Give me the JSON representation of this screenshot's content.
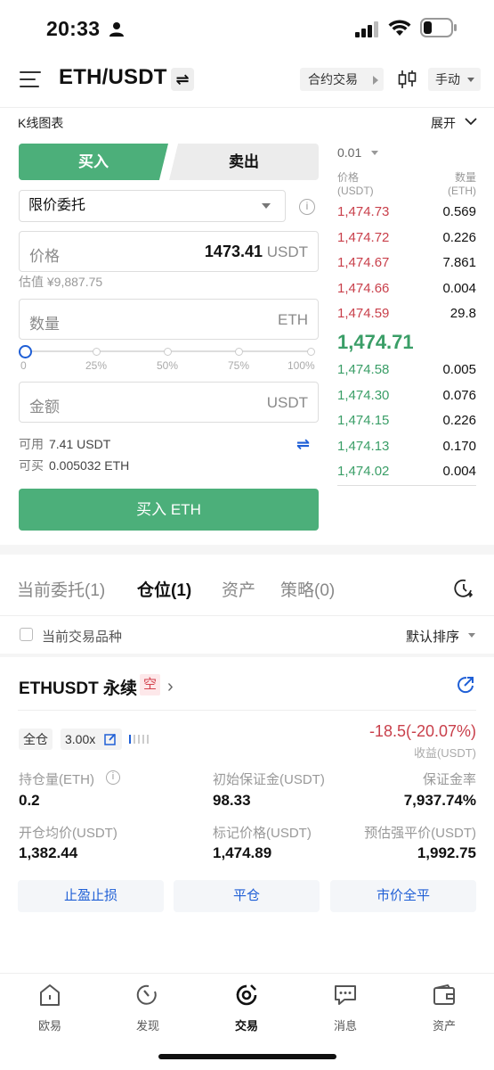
{
  "status_bar": {
    "time": "20:33"
  },
  "header": {
    "pair": "ETH/USDT",
    "swap_symbol": "⇌",
    "contract_label": "合约交易",
    "manual_label": "手动"
  },
  "kline": {
    "label": "K线图表",
    "expand_label": "展开"
  },
  "trade": {
    "buy_tab": "买入",
    "sell_tab": "卖出",
    "order_type": "限价委托",
    "price_placeholder": "价格",
    "price_value": "1473.41",
    "price_unit": "USDT",
    "estimate": "估值 ¥9,887.75",
    "qty_placeholder": "数量",
    "qty_unit": "ETH",
    "slider_value": 0,
    "slider_ticks": [
      "0",
      "25%",
      "50%",
      "75%",
      "100%"
    ],
    "amount_placeholder": "金额",
    "amount_unit": "USDT",
    "available_label": "可用",
    "available_value": "7.41 USDT",
    "canbuy_label": "可买",
    "canbuy_value": "0.005032 ETH",
    "buy_button": "买入 ETH"
  },
  "orderbook": {
    "precision": "0.01",
    "price_header": "价格",
    "price_unit": "(USDT)",
    "qty_header": "数量",
    "qty_unit": "(ETH)",
    "asks": [
      {
        "price": "1,474.73",
        "qty": "0.569"
      },
      {
        "price": "1,474.72",
        "qty": "0.226"
      },
      {
        "price": "1,474.67",
        "qty": "7.861"
      },
      {
        "price": "1,474.66",
        "qty": "0.004"
      },
      {
        "price": "1,474.59",
        "qty": "29.8"
      }
    ],
    "mid": "1,474.71",
    "bids": [
      {
        "price": "1,474.58",
        "qty": "0.005"
      },
      {
        "price": "1,474.30",
        "qty": "0.076"
      },
      {
        "price": "1,474.15",
        "qty": "0.226"
      },
      {
        "price": "1,474.13",
        "qty": "0.170"
      },
      {
        "price": "1,474.02",
        "qty": "0.004"
      }
    ]
  },
  "tabs": [
    "当前委托(1)",
    "仓位(1)",
    "资产",
    "策略(0)"
  ],
  "filter": {
    "checkbox_label": "当前交易品种",
    "sort_label": "默认排序"
  },
  "position": {
    "title": "ETHUSDT 永续",
    "side_badge": "空",
    "margin_mode": "全仓",
    "leverage": "3.00x",
    "pnl": "-18.5(-20.07%)",
    "pnl_label": "收益(USDT)",
    "stats": [
      {
        "label": "持仓量(ETH)",
        "value": "0.2"
      },
      {
        "label": "初始保证金(USDT)",
        "value": "98.33"
      },
      {
        "label": "保证金率",
        "value": "7,937.74%"
      },
      {
        "label": "开仓均价(USDT)",
        "value": "1,382.44"
      },
      {
        "label": "标记价格(USDT)",
        "value": "1,474.89"
      },
      {
        "label": "预估强平价(USDT)",
        "value": "1,992.75"
      }
    ],
    "actions": [
      "止盈止损",
      "平仓",
      "市价全平"
    ]
  },
  "nav": [
    "欧易",
    "发现",
    "交易",
    "消息",
    "资产"
  ],
  "colors": {
    "buy": "#4caf7a",
    "sell": "#c9404b",
    "link": "#1f5fd6"
  }
}
